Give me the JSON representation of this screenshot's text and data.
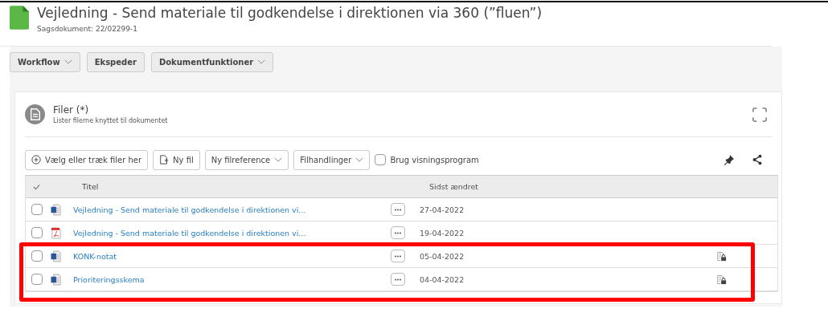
{
  "document": {
    "title": "Vejledning - Send materiale til godkendelse i direktionen via 360 (”fluen”)",
    "subtitle": "Sagsdokument: 22/02299-1"
  },
  "toolbar": [
    {
      "label": "Workflow",
      "dropdown": true
    },
    {
      "label": "Ekspeder",
      "dropdown": false
    },
    {
      "label": "Dokumentfunktioner",
      "dropdown": true
    }
  ],
  "panel": {
    "title": "Filer (*)",
    "subtitle": "Lister filerne knyttet til dokumentet"
  },
  "file_actions": [
    {
      "label": "Vælg eller træk filer her",
      "kind": "add"
    },
    {
      "label": "Ny fil",
      "kind": "new"
    },
    {
      "label": "Ny filreference",
      "kind": "dropdown"
    },
    {
      "label": "Filhandlinger",
      "kind": "dropdown"
    }
  ],
  "viewer_option": {
    "label": "Brug visningsprogram",
    "checked": false
  },
  "table": {
    "columns": [
      "Titel",
      "Sidst ændret"
    ],
    "rows": [
      {
        "kind": "word",
        "title": "Vejledning - Send materiale til godkendelse i direktionen vi...",
        "date": "27-04-2022",
        "locked": false,
        "checked": false,
        "highlighted": false
      },
      {
        "kind": "pdf",
        "title": "Vejledning - Send materiale til godkendelse i direktionen vi...",
        "date": "19-04-2022",
        "locked": false,
        "checked": false,
        "highlighted": false
      },
      {
        "kind": "word",
        "title": "KONK-notat",
        "date": "05-04-2022",
        "locked": true,
        "checked": false,
        "highlighted": true
      },
      {
        "kind": "word",
        "title": "Prioriteringsskema",
        "date": "04-04-2022",
        "locked": true,
        "checked": false,
        "highlighted": true
      }
    ]
  }
}
